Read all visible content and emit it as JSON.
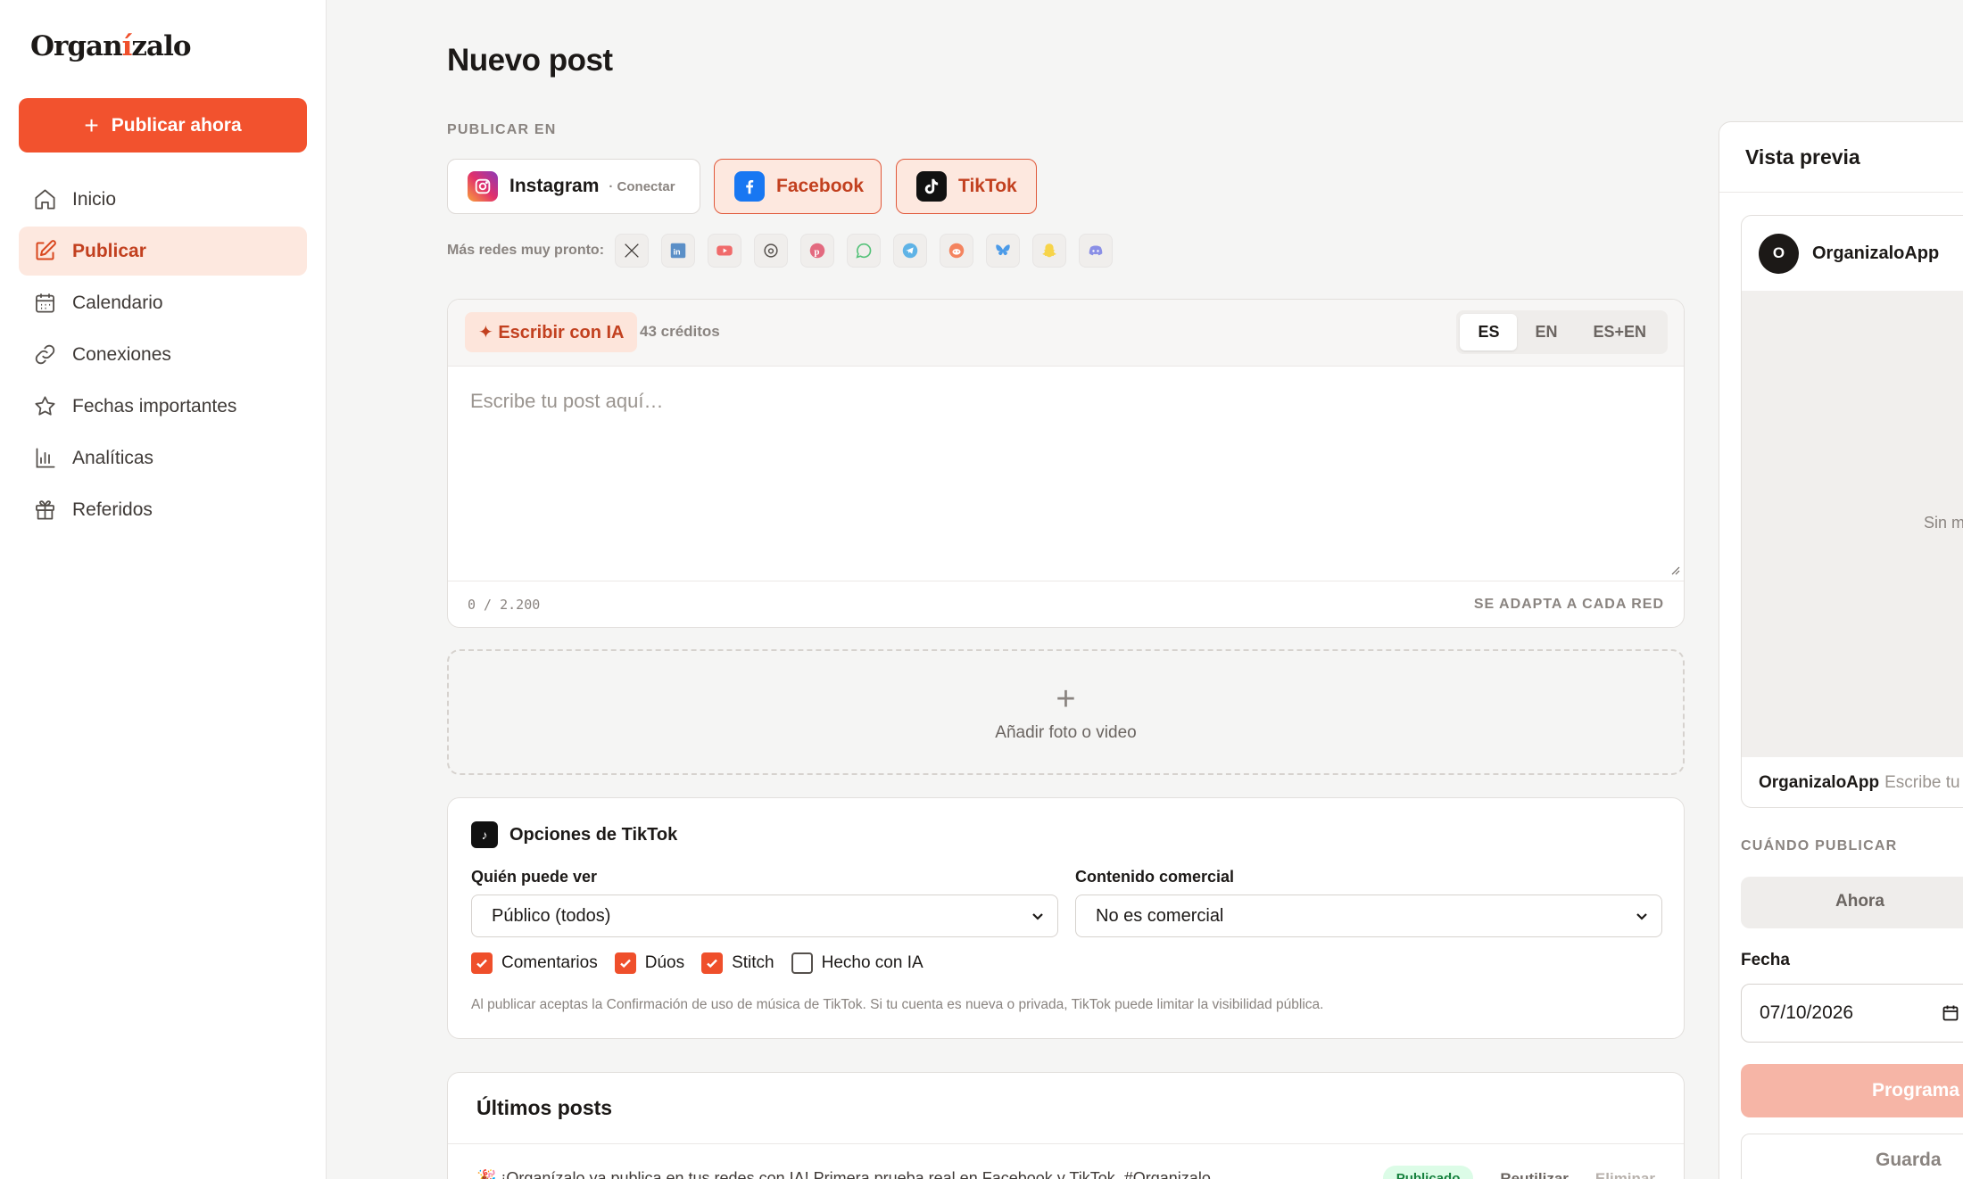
{
  "brand": {
    "name_before": "Organ",
    "name_accent": "í",
    "name_after": "zalo",
    "accent_color": "#f2522e"
  },
  "sidebar": {
    "publish_label": "Publicar ahora",
    "items": [
      {
        "label": "Inicio",
        "icon": "home-icon"
      },
      {
        "label": "Publicar",
        "icon": "edit-icon",
        "active": true
      },
      {
        "label": "Calendario",
        "icon": "calendar-icon"
      },
      {
        "label": "Conexiones",
        "icon": "link-icon"
      },
      {
        "label": "Fechas importantes",
        "icon": "star-icon"
      },
      {
        "label": "Analíticas",
        "icon": "bar-chart-icon"
      },
      {
        "label": "Referidos",
        "icon": "gift-icon"
      }
    ]
  },
  "main": {
    "title": "Nuevo post",
    "publish_in_label": "Publicar en",
    "networks": [
      {
        "name": "Instagram",
        "sub": "· Conectar",
        "selected": false
      },
      {
        "name": "Facebook",
        "selected": true
      },
      {
        "name": "TikTok",
        "selected": true
      }
    ],
    "soon_label": "Más redes muy pronto:",
    "soon_icons": [
      "x-icon",
      "linkedin-icon",
      "youtube-icon",
      "threads-icon",
      "pinterest-icon",
      "whatsapp-icon",
      "telegram-icon",
      "reddit-icon",
      "bluesky-icon",
      "snapchat-icon",
      "discord-icon"
    ],
    "editor": {
      "ai_label": "✦ Escribir con IA",
      "credits": "43 créditos",
      "languages": [
        "ES",
        "EN",
        "ES+EN"
      ],
      "active_language": "ES",
      "placeholder": "Escribe tu post aquí…",
      "counter": "0 / 2.200",
      "adapt_label": "SE ADAPTA A CADA RED"
    },
    "upload_label": "Añadir foto o video",
    "tiktok_options": {
      "title": "Opciones de TikTok",
      "who_label": "Quién puede ver",
      "who_value": "Público (todos)",
      "commercial_label": "Contenido comercial",
      "commercial_value": "No es comercial",
      "checks": [
        {
          "label": "Comentarios",
          "checked": true
        },
        {
          "label": "Dúos",
          "checked": true
        },
        {
          "label": "Stitch",
          "checked": true
        },
        {
          "label": "Hecho con IA",
          "checked": false
        }
      ],
      "legal": "Al publicar aceptas la Confirmación de uso de música de TikTok. Si tu cuenta es nueva o privada, TikTok puede limitar la visibilidad pública."
    },
    "recent": {
      "title": "Últimos posts",
      "rows": [
        {
          "text": "🎉 ¡Organízalo ya publica en tus redes con IA! Primera prueba real en Facebook y TikTok. #Organizalo",
          "status": "Publicado",
          "reuse": "Reutilizar",
          "delete": "Eliminar"
        }
      ]
    }
  },
  "preview": {
    "title": "Vista previa",
    "username": "OrganizaloApp",
    "avatar_letter": "O",
    "no_media": "Sin m",
    "caption_user": "OrganizaloApp",
    "caption_placeholder": "Escribe tu",
    "when_label": "Cuándo publicar",
    "now_label": "Ahora",
    "date_label": "Fecha",
    "date_value": "07/10/2026",
    "schedule_label": "Programa",
    "save_label": "Guarda"
  }
}
